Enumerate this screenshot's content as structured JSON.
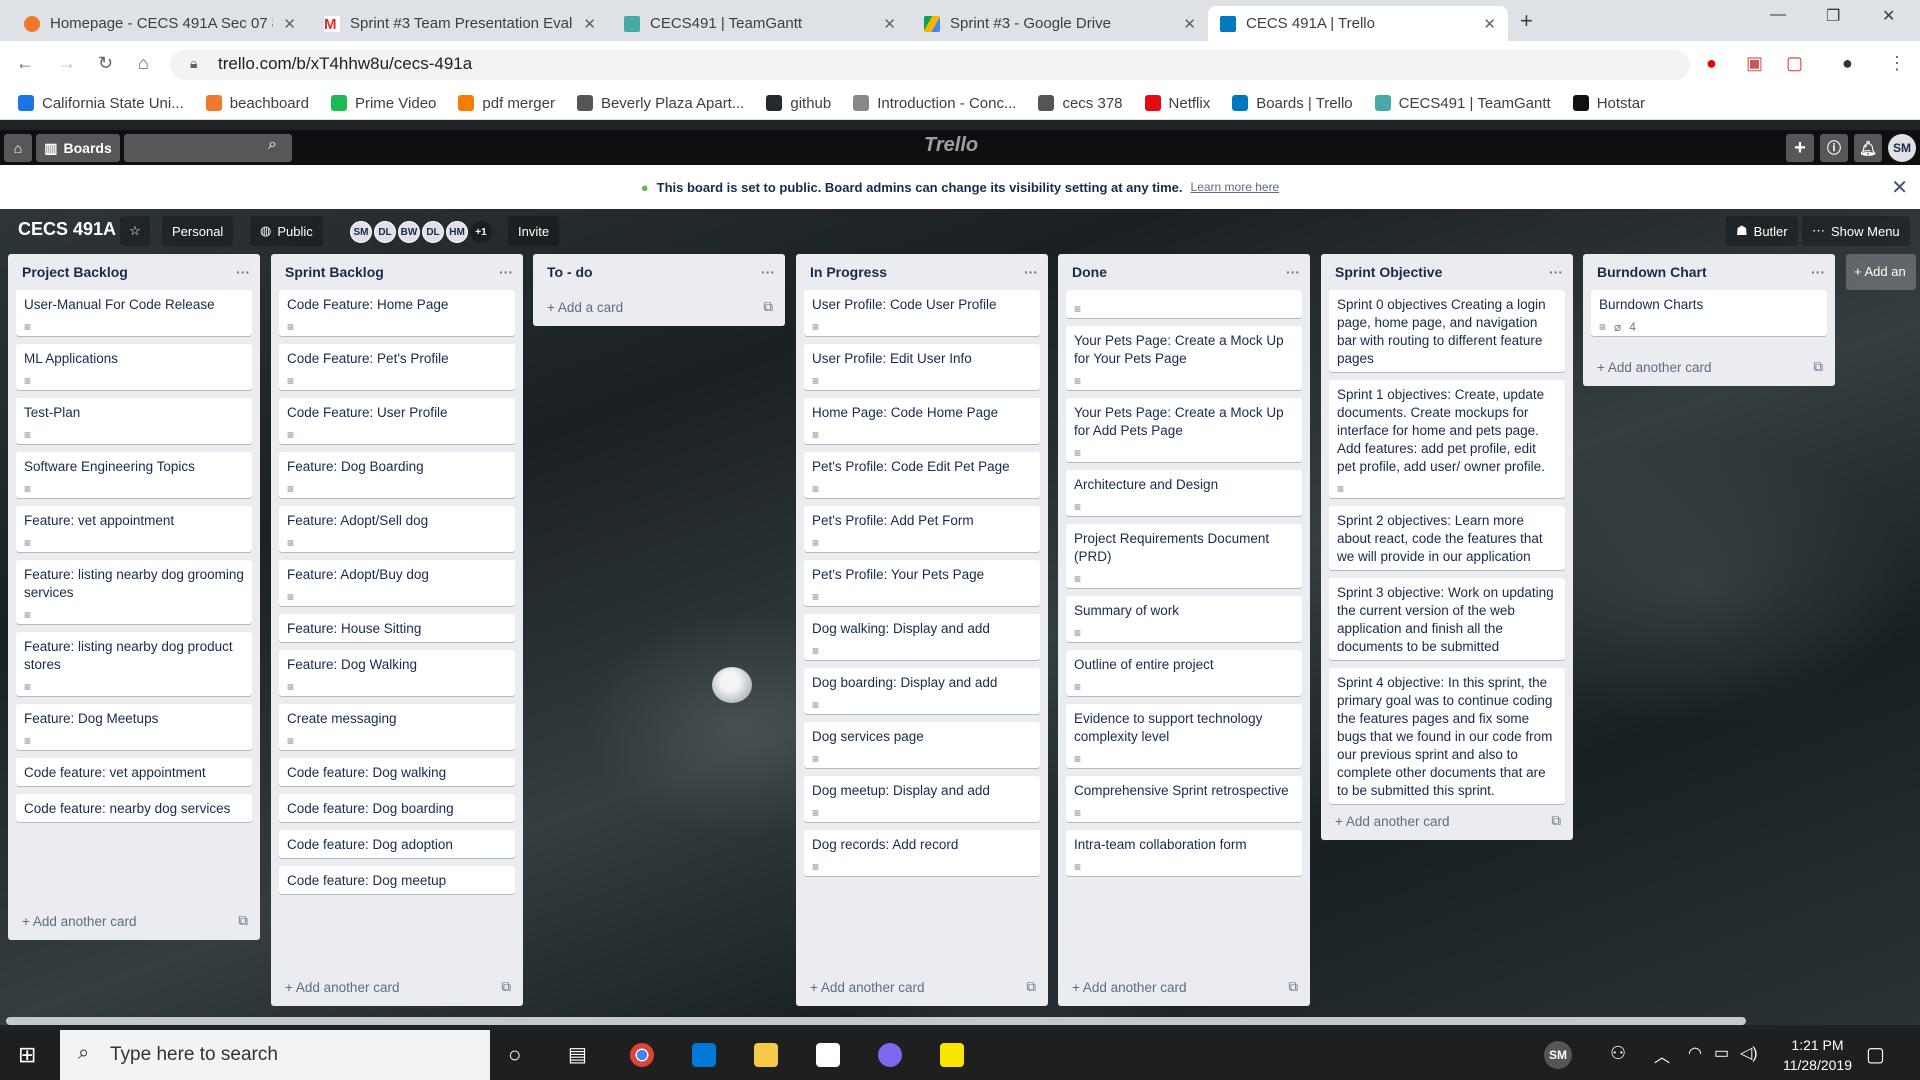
{
  "browser": {
    "tabs": [
      {
        "title": "Homepage - CECS 491A Sec 07 8",
        "icon": "blackboard-icon",
        "color": "#f0782d"
      },
      {
        "title": "Sprint #3 Team Presentation Eval",
        "icon": "gmail-icon",
        "color": "#d93025"
      },
      {
        "title": "CECS491 | TeamGantt",
        "icon": "teamgantt-icon",
        "color": "#48a9a6"
      },
      {
        "title": "Sprint #3 - Google Drive",
        "icon": "google-drive-icon",
        "color": "#f4b400"
      },
      {
        "title": "CECS 491A | Trello",
        "icon": "trello-icon",
        "color": "#0079bf"
      }
    ],
    "url": "trello.com/b/xT4hhw8u/cecs-491a",
    "bookmarks": [
      {
        "label": "California State Uni...",
        "color": "#1a73e8"
      },
      {
        "label": "beachboard",
        "color": "#f0782d"
      },
      {
        "label": "Prime Video",
        "color": "#1db954"
      },
      {
        "label": "pdf merger",
        "color": "#f57c00"
      },
      {
        "label": "Beverly Plaza Apart...",
        "color": "#555555"
      },
      {
        "label": "github",
        "color": "#24292e"
      },
      {
        "label": "Introduction - Conc...",
        "color": "#888888"
      },
      {
        "label": "cecs 378",
        "color": "#555555"
      },
      {
        "label": "Netflix",
        "color": "#e50914"
      },
      {
        "label": "Boards | Trello",
        "color": "#0079bf"
      },
      {
        "label": "CECS491 | TeamGantt",
        "color": "#48a9a6"
      },
      {
        "label": "Hotstar",
        "color": "#111111"
      }
    ]
  },
  "trello": {
    "boards_label": "Boards",
    "logo": "Trello",
    "user_initials": "SM",
    "banner_text": "This board is set to public. Board admins can change its visibility setting at any time.",
    "banner_link": "Learn more here",
    "board_title": "CECS 491A",
    "team_label": "Personal",
    "visibility_label": "Public",
    "members": [
      "SM",
      "DL",
      "BW",
      "DL",
      "HM"
    ],
    "members_more": "+1",
    "invite_label": "Invite",
    "butler_label": "Butler",
    "show_menu_label": "Show Menu",
    "add_list_label": "Add an"
  },
  "lists": [
    {
      "title": "Project Backlog",
      "add": "Add another card",
      "cards": [
        {
          "text": "User-Manual For Code Release",
          "desc": true
        },
        {
          "text": "ML Applications",
          "desc": true
        },
        {
          "text": "Test-Plan",
          "desc": true
        },
        {
          "text": "Software Engineering Topics",
          "desc": true
        },
        {
          "text": "Feature: vet appointment",
          "desc": true
        },
        {
          "text": "Feature: listing nearby dog grooming services",
          "desc": true
        },
        {
          "text": "Feature: listing nearby dog product stores",
          "desc": true
        },
        {
          "text": "Feature: Dog Meetups",
          "desc": true
        },
        {
          "text": "Code feature: vet appointment",
          "desc": false
        },
        {
          "text": "Code feature: nearby dog services",
          "desc": false
        }
      ]
    },
    {
      "title": "Sprint Backlog",
      "add": "Add another card",
      "cards": [
        {
          "text": "Code Feature: Home Page",
          "desc": true
        },
        {
          "text": "Code Feature: Pet's Profile",
          "desc": true
        },
        {
          "text": "Code Feature: User Profile",
          "desc": true
        },
        {
          "text": "Feature: Dog Boarding",
          "desc": true
        },
        {
          "text": "Feature: Adopt/Sell dog",
          "desc": true
        },
        {
          "text": "Feature: Adopt/Buy dog",
          "desc": true
        },
        {
          "text": "Feature: House Sitting",
          "desc": false
        },
        {
          "text": "Feature: Dog Walking",
          "desc": true
        },
        {
          "text": "Create messaging",
          "desc": true
        },
        {
          "text": "Code feature: Dog walking",
          "desc": false
        },
        {
          "text": "Code feature: Dog boarding",
          "desc": false
        },
        {
          "text": "Code feature: Dog adoption",
          "desc": false
        },
        {
          "text": "Code feature: Dog meetup",
          "desc": false
        }
      ]
    },
    {
      "title": "To - do",
      "add": "Add a card",
      "cards": []
    },
    {
      "title": "In Progress",
      "add": "Add another card",
      "cards": [
        {
          "text": "User Profile: Code User Profile",
          "desc": true
        },
        {
          "text": "User Profile: Edit User Info",
          "desc": true
        },
        {
          "text": "Home Page: Code Home Page",
          "desc": true
        },
        {
          "text": "Pet's Profile: Code Edit Pet Page",
          "desc": true
        },
        {
          "text": "Pet's Profile: Add Pet Form",
          "desc": true
        },
        {
          "text": "Pet's Profile: Your Pets Page",
          "desc": true
        },
        {
          "text": "Dog walking: Display and add",
          "desc": true
        },
        {
          "text": "Dog boarding: Display and add",
          "desc": true
        },
        {
          "text": "Dog services page",
          "desc": true
        },
        {
          "text": "Dog meetup: Display and add",
          "desc": true
        },
        {
          "text": "Dog records: Add record",
          "desc": true
        }
      ]
    },
    {
      "title": "Done",
      "add": "Add another card",
      "cards": [
        {
          "text": "",
          "desc": true
        },
        {
          "text": "Your Pets Page: Create a Mock Up for Your Pets Page",
          "desc": true
        },
        {
          "text": "Your Pets Page: Create a Mock Up for Add Pets Page",
          "desc": true
        },
        {
          "text": "Architecture and Design",
          "desc": true
        },
        {
          "text": "Project Requirements Document (PRD)",
          "desc": true
        },
        {
          "text": "Summary of work",
          "desc": true
        },
        {
          "text": "Outline of entire project",
          "desc": true
        },
        {
          "text": "Evidence to support technology complexity level",
          "desc": true
        },
        {
          "text": "Comprehensive Sprint retrospective",
          "desc": true
        },
        {
          "text": "Intra-team collaboration form",
          "desc": true
        }
      ]
    },
    {
      "title": "Sprint Objective",
      "add": "Add another card",
      "cards": [
        {
          "text": "Sprint 0 objectives Creating a login page, home page, and navigation bar with routing to different feature pages",
          "desc": false
        },
        {
          "text": "Sprint 1 objectives: Create, update documents. Create mockups for interface for home and pets page. Add features: add pet profile, edit pet profile, add user/ owner profile.",
          "desc": true
        },
        {
          "text": "Sprint 2 objectives: Learn more about react, code the features that we will provide in our application",
          "desc": false
        },
        {
          "text": "Sprint 3 objective: Work on updating the current version of the web application and finish all the documents to be submitted",
          "desc": false
        },
        {
          "text": "Sprint 4 objective: In this sprint, the primary goal was to continue coding the features pages and fix some bugs that we found in our code from our previous sprint and also to complete other documents that are to be submitted this sprint.",
          "desc": false
        }
      ]
    },
    {
      "title": "Burndown Chart",
      "add": "Add another card",
      "cards": [
        {
          "text": "Burndown Charts",
          "desc": true,
          "attachments": "4"
        }
      ]
    }
  ],
  "taskbar": {
    "search_placeholder": "Type here to search",
    "user_initials": "SM",
    "time": "1:21 PM",
    "date": "11/28/2019"
  }
}
